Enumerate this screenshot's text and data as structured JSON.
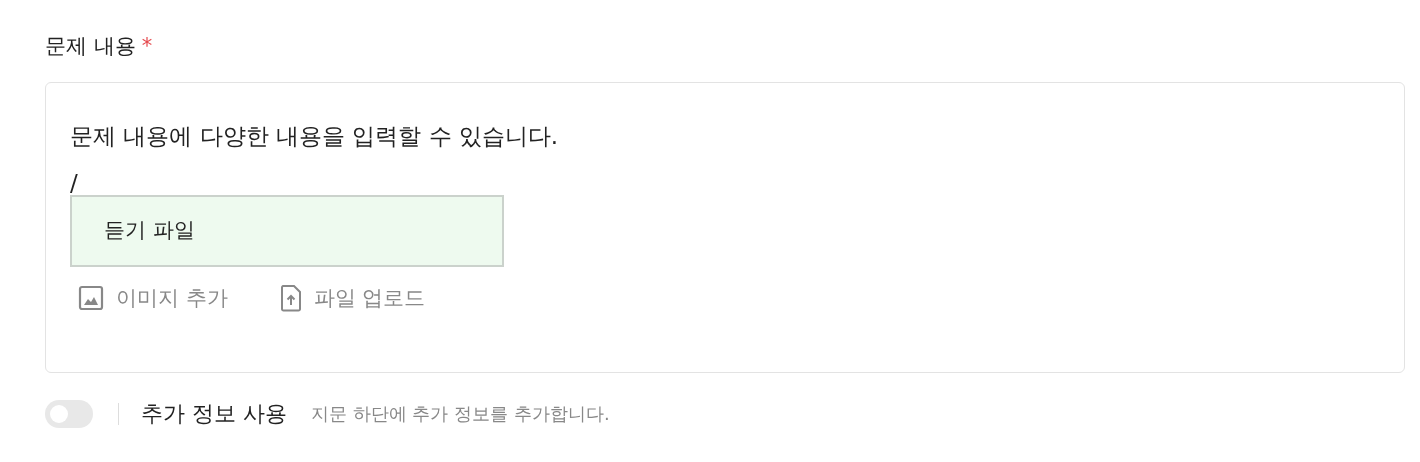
{
  "field": {
    "label": "문제 내용",
    "required": true,
    "required_mark": "*"
  },
  "editor": {
    "paragraphs": [
      "문제 내용에 다양한 내용을 입력할 수 있습니다.",
      "/"
    ],
    "menu": [
      {
        "label": "듣기 파일",
        "selected": true
      }
    ],
    "toolbar": [
      {
        "kind": "image",
        "label": "이미지 추가"
      },
      {
        "kind": "file",
        "label": "파일 업로드"
      }
    ]
  },
  "extra": {
    "on": false,
    "label": "추가 정보 사용",
    "hint": "지문 하단에 추가 정보를 추가합니다."
  }
}
